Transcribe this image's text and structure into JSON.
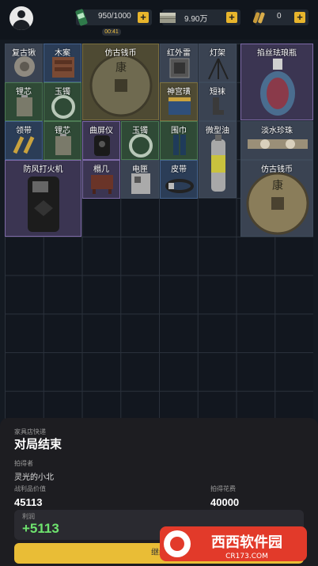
{
  "header": {
    "energy_value": "950/1000",
    "money_value": "9.90万",
    "bullets_value": "0",
    "timer": "00:41",
    "plus_label": "+"
  },
  "items": [
    {
      "label": "复古锹"
    },
    {
      "label": "木案"
    },
    {
      "label": "仿古钱币"
    },
    {
      "label": "红外雷"
    },
    {
      "label": "灯架"
    },
    {
      "label": "掐丝珐琅瓶"
    },
    {
      "label": "锂芯"
    },
    {
      "label": "玉镯"
    },
    {
      "label": "神宫璜"
    },
    {
      "label": "短袜"
    },
    {
      "label": "领带"
    },
    {
      "label": "锂芯"
    },
    {
      "label": "曲屏仪"
    },
    {
      "label": "玉镯"
    },
    {
      "label": "围巾"
    },
    {
      "label": "微型油"
    },
    {
      "label": "淡水珍珠"
    },
    {
      "label": "防风打火机"
    },
    {
      "label": "榻几"
    },
    {
      "label": "电匣"
    },
    {
      "label": "皮带"
    },
    {
      "label": "仿古钱币"
    }
  ],
  "panel": {
    "subtitle": "家具店快递",
    "title": "对局结束",
    "bidder_label": "拍得者",
    "bidder_name": "灵光的小北",
    "value_label": "战利品价值",
    "value": "45113",
    "cost_label": "拍得花费",
    "cost": "40000",
    "profit_label": "利润",
    "profit": "+5113",
    "continue_label": "继续"
  },
  "watermark": {
    "text": "西西软件园",
    "url": "CR173.COM"
  },
  "colors": {
    "accent_gold": "#e9bd36",
    "profit_green": "#6ee36e"
  }
}
